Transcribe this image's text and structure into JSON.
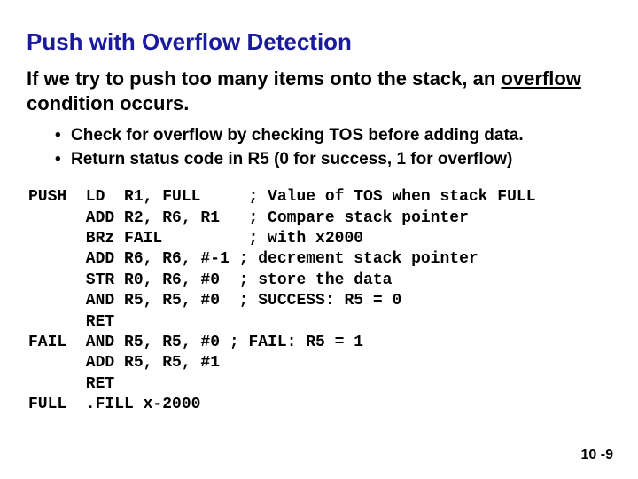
{
  "title": "Push with Overflow Detection",
  "intro_part1": "If we try to push too many items onto the stack, an ",
  "intro_overflow": "overflow",
  "intro_part2": " condition occurs.",
  "bullets": [
    "Check for overflow by checking TOS before adding data.",
    "Return status code in R5 (0 for success, 1 for overflow)"
  ],
  "code": "PUSH  LD  R1, FULL     ; Value of TOS when stack FULL\n      ADD R2, R6, R1   ; Compare stack pointer\n      BRz FAIL         ; with x2000\n      ADD R6, R6, #-1 ; decrement stack pointer\n      STR R0, R6, #0  ; store the data\n      AND R5, R5, #0  ; SUCCESS: R5 = 0\n      RET\nFAIL  AND R5, R5, #0 ; FAIL: R5 = 1\n      ADD R5, R5, #1\n      RET\nFULL  .FILL x-2000",
  "page_num": "10 -9"
}
